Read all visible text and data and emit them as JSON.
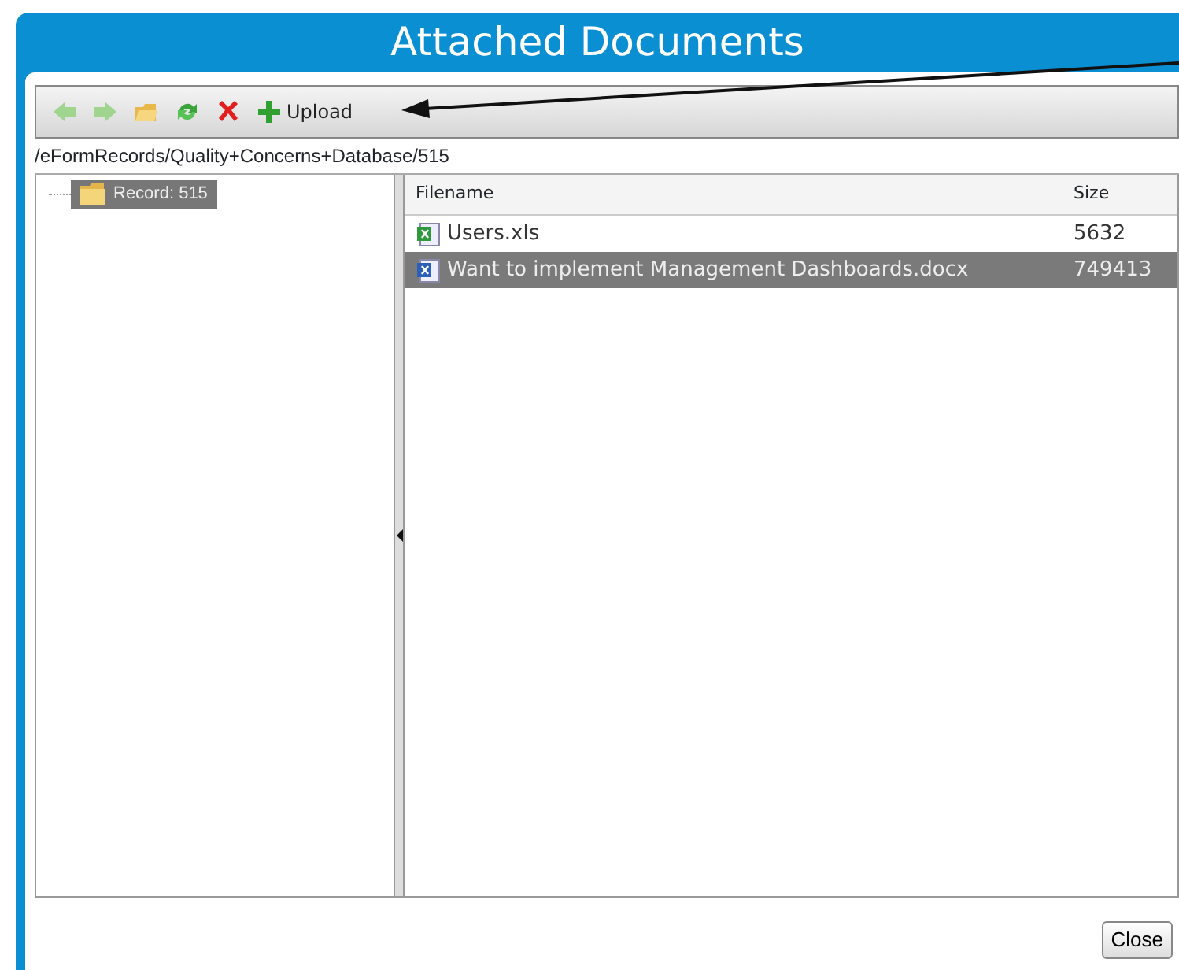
{
  "window": {
    "title": "Attached Documents"
  },
  "toolbar": [
    {
      "kind": "back"
    },
    {
      "kind": "forward"
    },
    {
      "kind": "open"
    },
    {
      "kind": "refresh"
    },
    {
      "kind": "delete"
    },
    {
      "kind": "upload",
      "label": "Upload"
    }
  ],
  "path": "/eFormRecords/Quality+Concerns+Database/515",
  "tree": [
    {
      "label": "Record: 515",
      "selected": true
    }
  ],
  "table": {
    "columns": [
      "Filename",
      "Size"
    ],
    "rows": [
      {
        "kind": "xls",
        "filename": "Users.xls",
        "size": "5632",
        "selected": false
      },
      {
        "kind": "doc",
        "filename": "Want to implement Management Dashboards.docx",
        "size": "749413",
        "selected": true
      }
    ]
  },
  "buttons": [
    "Close"
  ]
}
